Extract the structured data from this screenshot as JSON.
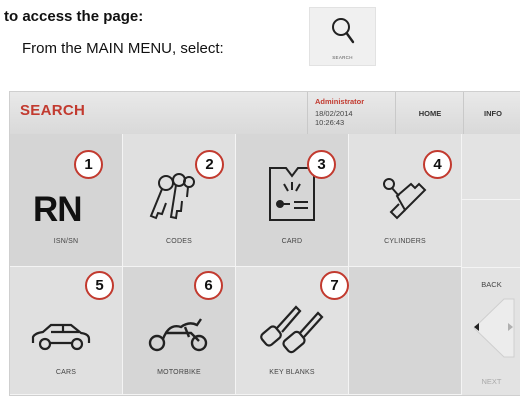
{
  "intro": {
    "heading": "to access the page:",
    "line": "From the MAIN MENU, select:"
  },
  "search_tile": {
    "label": "SEARCH",
    "icon": "search-icon"
  },
  "header": {
    "title": "SEARCH",
    "user": "Administrator",
    "date": "18/02/2014",
    "time": "10:26:43",
    "home_label": "HOME",
    "info_label": "INFO"
  },
  "tiles": [
    {
      "number": "1",
      "label": "ISN/SN",
      "icon": "rn-icon"
    },
    {
      "number": "2",
      "label": "CODES",
      "icon": "keys-icon"
    },
    {
      "number": "3",
      "label": "CARD",
      "icon": "card-icon"
    },
    {
      "number": "4",
      "label": "CYLINDERS",
      "icon": "cylinder-key-icon"
    },
    {
      "number": "5",
      "label": "CARS",
      "icon": "car-icon"
    },
    {
      "number": "6",
      "label": "MOTORBIKE",
      "icon": "motorbike-icon"
    },
    {
      "number": "7",
      "label": "KEY BLANKS",
      "icon": "key-blanks-icon"
    }
  ],
  "rn_text": "RN",
  "side": {
    "back_label": "BACK",
    "next_label": "NEXT"
  },
  "colors": {
    "accent": "#c23a2f",
    "panel": "#e6e6e6"
  }
}
